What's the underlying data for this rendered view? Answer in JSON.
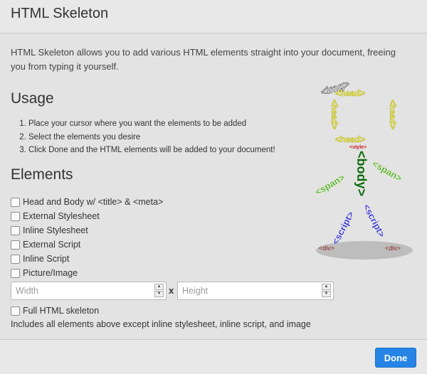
{
  "header": {
    "title": "HTML Skeleton"
  },
  "intro": "HTML Skeleton allows you to add various HTML elements straight into your document, freeing you from typing it yourself.",
  "usage": {
    "title": "Usage",
    "steps": [
      "Place your cursor where you want the elements to be added",
      "Select the elements you desire",
      "Click Done and the HTML elements will be added to your document!"
    ]
  },
  "elements": {
    "title": "Elements",
    "items": [
      {
        "label": "Head and Body w/ <title> & <meta>",
        "checked": false
      },
      {
        "label": "External Stylesheet",
        "checked": false
      },
      {
        "label": "Inline Stylesheet",
        "checked": false
      },
      {
        "label": "External Script",
        "checked": false
      },
      {
        "label": "Inline Script",
        "checked": false
      },
      {
        "label": "Picture/Image",
        "checked": false
      }
    ],
    "width_placeholder": "Width",
    "height_placeholder": "Height",
    "dimension_separator": "x",
    "full": {
      "label": "Full HTML skeleton",
      "checked": false
    },
    "full_note": "Includes all elements above except inline stylesheet, inline script, and image"
  },
  "illustration": {
    "img": "<img>",
    "head": "<head>",
    "style": "<style>",
    "body": "<body>",
    "span": "<span>",
    "script": "<script>",
    "div": "<div>"
  },
  "footer": {
    "done_label": "Done"
  },
  "colors": {
    "accent": "#2684e6",
    "head": "#c8c31a",
    "body": "#0b6b0b",
    "span": "#33a833",
    "script": "#2828c8",
    "style": "#c81e1e",
    "div": "#8b2222",
    "img": "#666666"
  }
}
